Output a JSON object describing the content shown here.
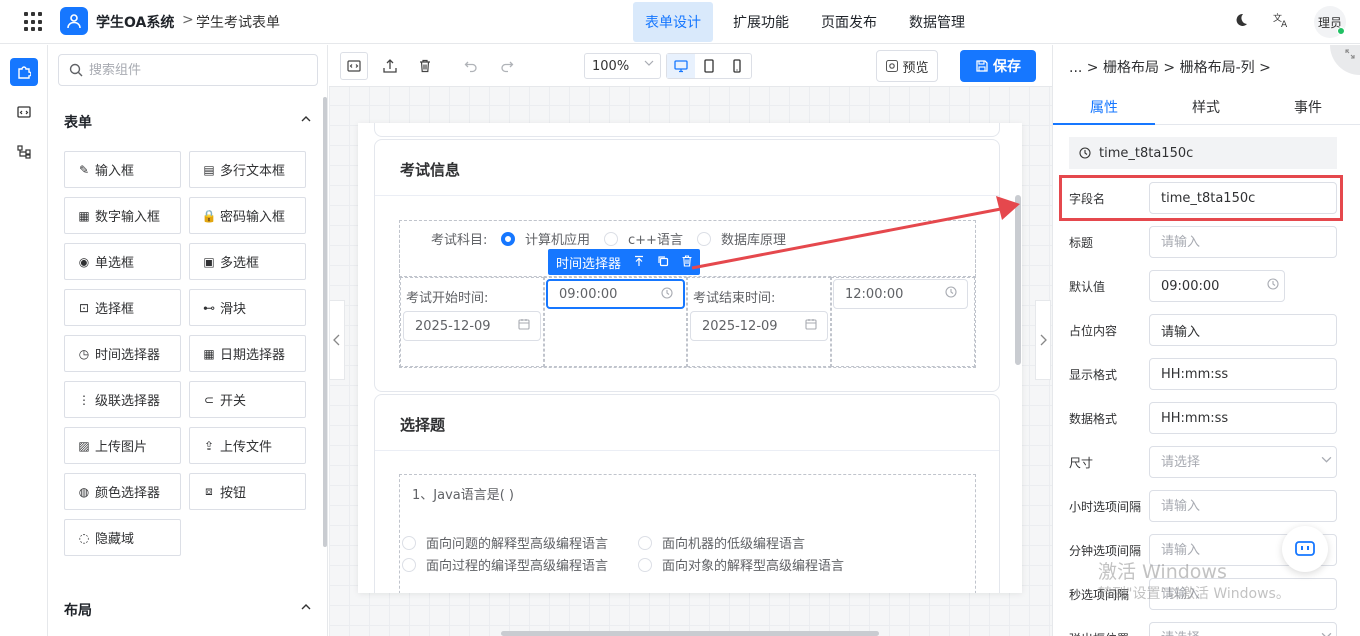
{
  "header": {
    "app_title": "学生OA系统",
    "crumb_sep": ">",
    "page_crumb": "学生考试表单",
    "nav": [
      {
        "label": "表单设计",
        "active": true
      },
      {
        "label": "扩展功能",
        "active": false
      },
      {
        "label": "页面发布",
        "active": false
      },
      {
        "label": "数据管理",
        "active": false
      }
    ],
    "user_label": "理员",
    "accent": "#1677ff"
  },
  "components": {
    "search_placeholder": "搜索组件",
    "form_section": "表单",
    "layout_section": "布局",
    "items": [
      {
        "label": "输入框",
        "icon": "pencil-icon"
      },
      {
        "label": "多行文本框",
        "icon": "textarea-icon"
      },
      {
        "label": "数字输入框",
        "icon": "number-icon"
      },
      {
        "label": "密码输入框",
        "icon": "lock-icon"
      },
      {
        "label": "单选框",
        "icon": "radio-icon"
      },
      {
        "label": "多选框",
        "icon": "checkbox-icon"
      },
      {
        "label": "选择框",
        "icon": "select-icon"
      },
      {
        "label": "滑块",
        "icon": "slider-icon"
      },
      {
        "label": "时间选择器",
        "icon": "clock-icon"
      },
      {
        "label": "日期选择器",
        "icon": "calendar-icon"
      },
      {
        "label": "级联选择器",
        "icon": "cascader-icon"
      },
      {
        "label": "开关",
        "icon": "switch-icon"
      },
      {
        "label": "上传图片",
        "icon": "image-icon"
      },
      {
        "label": "上传文件",
        "icon": "upload-icon"
      },
      {
        "label": "颜色选择器",
        "icon": "palette-icon"
      },
      {
        "label": "按钮",
        "icon": "button-icon"
      },
      {
        "label": "隐藏域",
        "icon": "eye-off-icon"
      }
    ]
  },
  "toolbar": {
    "zoom": "100%",
    "preview_label": "预览",
    "save_label": "保存"
  },
  "canvas": {
    "exam_card_title": "考试信息",
    "subject_label": "考试科目:",
    "subject_options": [
      {
        "label": "计算机应用",
        "checked": true
      },
      {
        "label": "c++语言",
        "checked": false
      },
      {
        "label": "数据库原理",
        "checked": false
      }
    ],
    "selection_toolbar_label": "时间选择器",
    "start_time_label": "考试开始时间:",
    "start_date": "2025-12-09",
    "start_time": "09:00:00",
    "end_time_label": "考试结束时间:",
    "end_date": "2025-12-09",
    "end_time": "12:00:00",
    "choice_card_title": "选择题",
    "question": "1、Java语言是( )",
    "question_options": [
      "面向问题的解释型高级编程语言",
      "面向机器的低级编程语言",
      "面向过程的编译型高级编程语言",
      "面向对象的解释型高级编程语言"
    ]
  },
  "props": {
    "breadcrumb": "... > 栅格布局 > 栅格布局-列 >",
    "tabs": [
      "属性",
      "样式",
      "事件"
    ],
    "component_id": "time_t8ta150c",
    "rows": [
      {
        "label": "字段名",
        "value": "time_t8ta150c",
        "placeholder": ""
      },
      {
        "label": "标题",
        "value": "",
        "placeholder": "请输入"
      },
      {
        "label": "默认值",
        "value": "09:00:00",
        "placeholder": ""
      },
      {
        "label": "占位内容",
        "value": "请输入",
        "placeholder": ""
      },
      {
        "label": "显示格式",
        "value": "HH:mm:ss",
        "placeholder": ""
      },
      {
        "label": "数据格式",
        "value": "HH:mm:ss",
        "placeholder": ""
      },
      {
        "label": "尺寸",
        "value": "",
        "placeholder": "请选择"
      },
      {
        "label": "小时选项间隔",
        "value": "",
        "placeholder": "请输入"
      },
      {
        "label": "分钟选项间隔",
        "value": "",
        "placeholder": "请输入"
      },
      {
        "label": "秒选项间隔",
        "value": "",
        "placeholder": "请输入"
      },
      {
        "label": "弹出框位置",
        "value": "",
        "placeholder": "请选择"
      }
    ],
    "highlight_color": "#e5484d"
  },
  "watermark": {
    "line1": "激活 Windows",
    "line2": "转到\"设置\"以激活 Windows。"
  }
}
